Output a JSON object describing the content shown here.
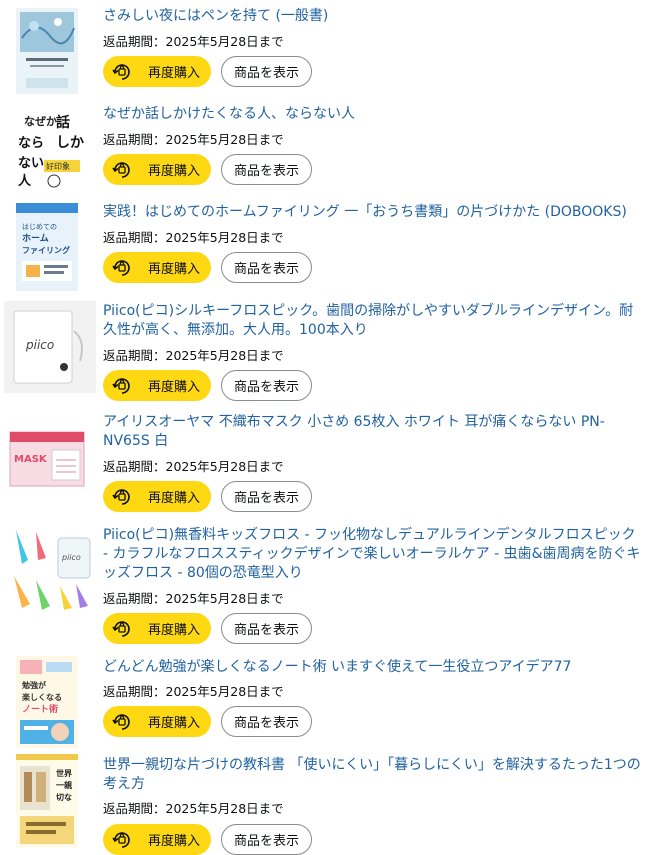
{
  "buttons": {
    "buy_again": "再度購入",
    "view_item": "商品を表示"
  },
  "items": [
    {
      "title": "さみしい夜にはペンを持て (一般書)",
      "return_text": "返品期間：2025年5月28日まで"
    },
    {
      "title": "なぜか話しかけたくなる人、ならない人",
      "return_text": "返品期間：2025年5月28日まで"
    },
    {
      "title": "実践！はじめてのホームファイリング 一「おうち書類」の片づけかた (DOBOOKS)",
      "return_text": "返品期間：2025年5月28日まで"
    },
    {
      "title": "Piico(ピコ)シルキーフロスピック。歯間の掃除がしやすいダブルラインデザイン。耐久性が高く、無添加。大人用。100本入り",
      "return_text": "返品期間：2025年5月28日まで"
    },
    {
      "title": "アイリスオーヤマ 不織布マスク 小さめ 65枚入 ホワイト 耳が痛くならない PN-NV65S 白",
      "return_text": "返品期間：2025年5月28日まで"
    },
    {
      "title": "Piico(ピコ)無香料キッズフロス - フッ化物なしデュアルラインデンタルフロスピック - カラフルなフロススティックデザインで楽しいオーラルケア - 虫歯&歯周病を防ぐキッズフロス - 80個の恐竜型入り",
      "return_text": "返品期間：2025年5月28日まで"
    },
    {
      "title": "どんどん勉強が楽しくなるノート術 いますぐ使えて一生役立つアイデア77",
      "return_text": "返品期間：2025年5月28日まで"
    },
    {
      "title": "世界一親切な片づけの教科書 「使いにくい」「暮らしにくい」を解決するたった1つの考え方",
      "return_text": "返品期間：2025年5月28日まで"
    }
  ],
  "thumb_text": {
    "book2": "話しかけたくなる人、ならない人",
    "book3": "はじめてのホームファイリング",
    "piico": "piico",
    "mask": "MASK",
    "notebook": "勉強が楽しくなるノート術",
    "book8": "世界一親切な片づけの教科書"
  }
}
